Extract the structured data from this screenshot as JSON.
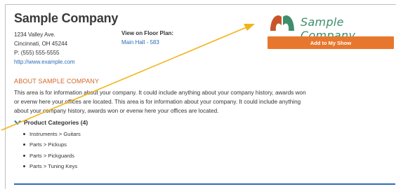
{
  "company": {
    "name": "Sample Company",
    "address_line1": "1234 Valley Ave.",
    "address_line2": "Cincinnati, OH 45244",
    "phone": "P: (555) 555-5555",
    "website": "http://www.example.com"
  },
  "floor_plan": {
    "title": "View on Floor Plan:",
    "link": "Main Hall - 583"
  },
  "logo": {
    "text": "Sample Company",
    "icon": "company-logo-icon",
    "colors": {
      "left": "#c8552a",
      "right": "#3e8e6c"
    }
  },
  "actions": {
    "add_label": "Add to My Show",
    "color": "#e8772e"
  },
  "about": {
    "title": "ABOUT SAMPLE COMPANY",
    "body": "This area is for information about your company. It could include anything about your company history, awards won or evenw here your offices are located. This area is for information about your company. It could include anything about your company history, awards won or evenw here your offices are located."
  },
  "categories": {
    "heading": "Product Categories (4)",
    "items": [
      "Instruments > Guitars",
      "Parts > Pickups",
      "Parts > Pickguards",
      "Parts > Tuning Keys"
    ]
  },
  "annotation": {
    "color": "#f2b31b"
  },
  "colors": {
    "link": "#2a6db5",
    "accent": "#d46426",
    "rule": "#2a6db5"
  }
}
